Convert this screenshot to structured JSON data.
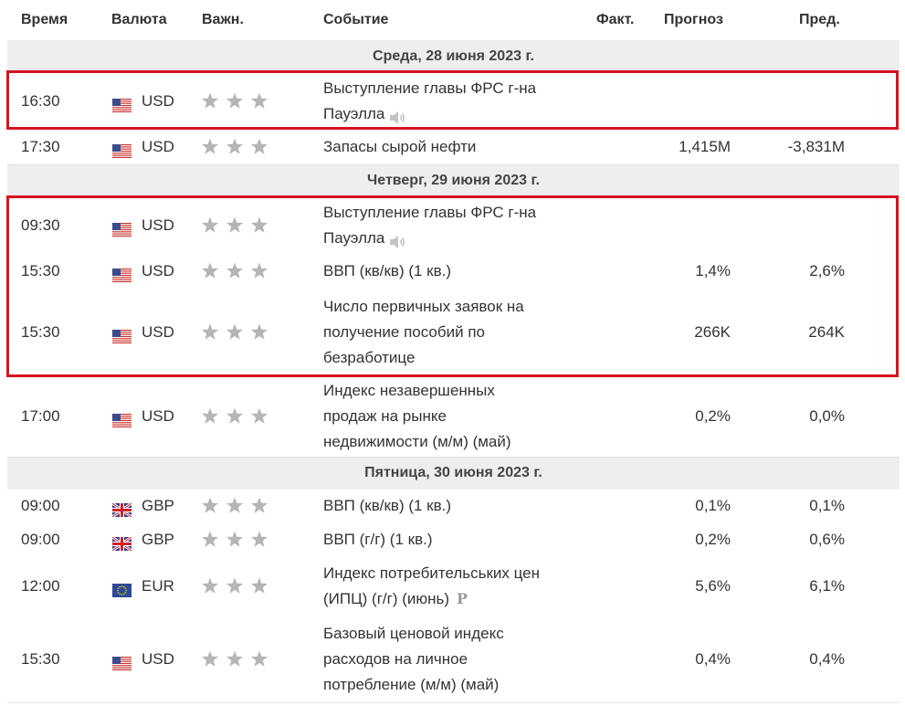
{
  "columns": {
    "time": "Время",
    "currency": "Валюта",
    "importance": "Важн.",
    "event": "Событие",
    "actual": "Факт.",
    "forecast": "Прогноз",
    "previous": "Пред."
  },
  "days": {
    "d1": "Среда, 28 июня 2023 г.",
    "d2": "Четверг, 29 июня 2023 г.",
    "d3": "Пятница, 30 июня 2023 г."
  },
  "rows": [
    {
      "time": "16:30",
      "currency": "USD",
      "flag": "us-flag",
      "importance": 3,
      "event_lines": [
        "Выступление главы ФРС г-на",
        "Пауэлла"
      ],
      "event_icon": "speaker-icon",
      "forecast": "",
      "previous": ""
    },
    {
      "time": "17:30",
      "currency": "USD",
      "flag": "us-flag",
      "importance": 3,
      "event_lines": [
        "Запасы сырой нефти"
      ],
      "forecast": "1,415M",
      "previous": "-3,831M"
    },
    {
      "time": "09:30",
      "currency": "USD",
      "flag": "us-flag",
      "importance": 3,
      "event_lines": [
        "Выступление главы ФРС г-на",
        "Пауэлла"
      ],
      "event_icon": "speaker-icon",
      "forecast": "",
      "previous": ""
    },
    {
      "time": "15:30",
      "currency": "USD",
      "flag": "us-flag",
      "importance": 3,
      "event_lines": [
        "ВВП (кв/кв) (1 кв.)"
      ],
      "forecast": "1,4%",
      "previous": "2,6%"
    },
    {
      "time": "15:30",
      "currency": "USD",
      "flag": "us-flag",
      "importance": 3,
      "event_lines": [
        "Число первичных заявок на",
        "получение пособий по",
        "безработице"
      ],
      "forecast": "266K",
      "previous": "264K"
    },
    {
      "time": "17:00",
      "currency": "USD",
      "flag": "us-flag",
      "importance": 3,
      "event_lines": [
        "Индекс незавершенных",
        "продаж на рынке",
        "недвижимости (м/м) (май)"
      ],
      "forecast": "0,2%",
      "previous": "0,0%"
    },
    {
      "time": "09:00",
      "currency": "GBP",
      "flag": "uk-flag",
      "importance": 3,
      "event_lines": [
        "ВВП (кв/кв) (1 кв.)"
      ],
      "forecast": "0,1%",
      "previous": "0,1%"
    },
    {
      "time": "09:00",
      "currency": "GBP",
      "flag": "uk-flag",
      "importance": 3,
      "event_lines": [
        "ВВП (г/г) (1 кв.)"
      ],
      "forecast": "0,2%",
      "previous": "0,6%"
    },
    {
      "time": "12:00",
      "currency": "EUR",
      "flag": "eu-flag",
      "importance": 3,
      "event_lines": [
        "Индекс потребительських цен",
        "(ИПЦ) (г/г) (июнь)"
      ],
      "event_mark": "P",
      "forecast": "5,6%",
      "previous": "6,1%"
    },
    {
      "time": "15:30",
      "currency": "USD",
      "flag": "us-flag",
      "importance": 3,
      "event_lines": [
        "Базовый ценовой индекс",
        "расходов на личное",
        "потребление (м/м) (май)"
      ],
      "forecast": "0,4%",
      "previous": "0,4%"
    }
  ],
  "colors": {
    "highlight": "#d9121f",
    "star": "#b5b5b5",
    "day_bar": "#eeeeee"
  }
}
